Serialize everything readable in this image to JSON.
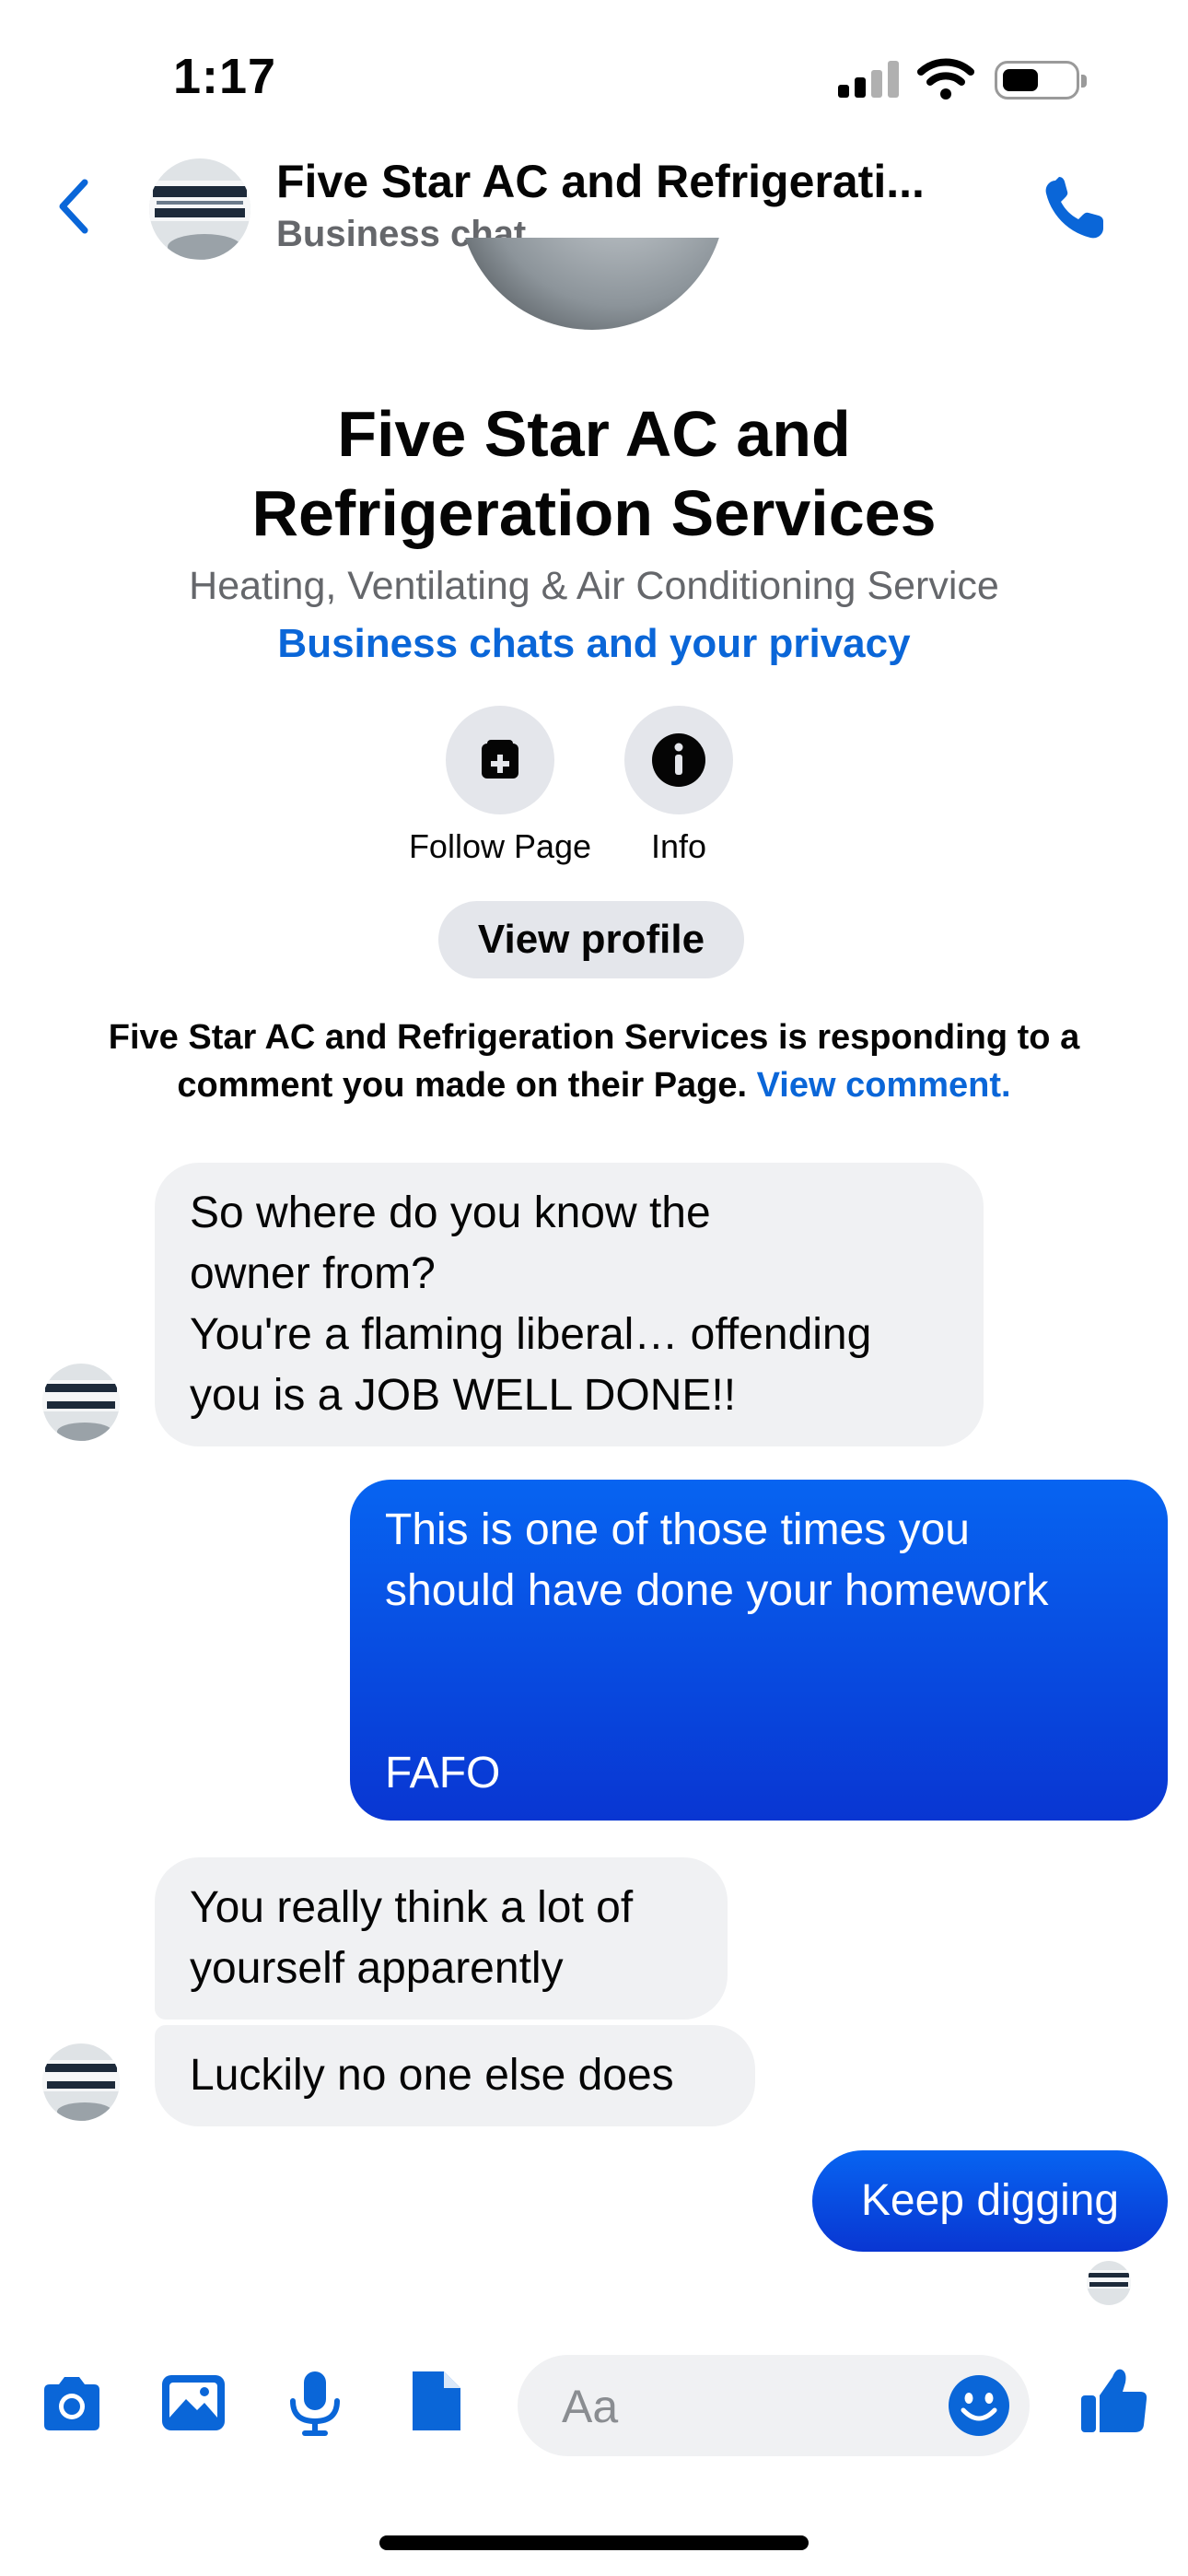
{
  "status_bar": {
    "time": "1:17"
  },
  "header": {
    "name": "Five Star AC and  Refrigerati...",
    "subtitle": "Business chat"
  },
  "page": {
    "title": "Five Star AC and Refrigeration Services",
    "category": "Heating, Ventilating & Air Conditioning Service",
    "privacy_link": "Business chats and your privacy",
    "actions": [
      {
        "label": "Follow Page",
        "icon": "follow-page-icon"
      },
      {
        "label": "Info",
        "icon": "info-icon"
      }
    ],
    "view_profile": "View profile",
    "notice_text": "Five Star AC and  Refrigeration Services is responding to a comment you made on their Page. ",
    "notice_link": "View comment."
  },
  "messages": [
    {
      "from": "them",
      "text": "So where do you know the\nowner from?\nYou're a flaming liberal… offending\nyou is a JOB WELL DONE!!"
    },
    {
      "from": "me",
      "text": "This is one of those times you\nshould have done your homework\n\n\nFAFO"
    },
    {
      "from": "them",
      "text": "You really think a lot of\nyourself apparently"
    },
    {
      "from": "them",
      "text": "Luckily no one else does"
    },
    {
      "from": "me",
      "text": "Keep digging"
    }
  ],
  "composer": {
    "placeholder": "Aa"
  },
  "colors": {
    "accent": "#0a66d8",
    "bubble_out": "#0936d2",
    "bubble_in": "#f0f1f3"
  }
}
